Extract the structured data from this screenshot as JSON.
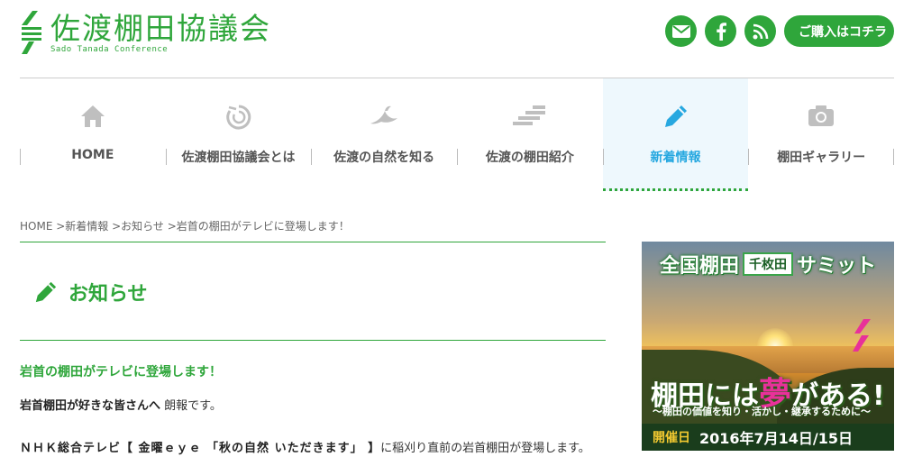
{
  "header": {
    "logo_title": "佐渡棚田協議会",
    "logo_subtitle": "Sado Tanada Conference",
    "icons": [
      "mail-icon",
      "facebook-icon",
      "rss-icon"
    ],
    "buy_label": "ご購入はコチラ"
  },
  "nav": {
    "items": [
      {
        "label": "HOME",
        "icon": "home-icon"
      },
      {
        "label": "佐渡棚田協議会とは",
        "icon": "swirl-icon"
      },
      {
        "label": "佐渡の自然を知る",
        "icon": "ibis-icon"
      },
      {
        "label": "佐渡の棚田紹介",
        "icon": "terrace-icon"
      },
      {
        "label": "新着情報",
        "icon": "pencil-icon",
        "active": true
      },
      {
        "label": "棚田ギャラリー",
        "icon": "camera-icon"
      }
    ]
  },
  "breadcrumb": "HOME >新着情報 >お知らせ >岩首の棚田がテレビに登場します！",
  "section": {
    "title": "お知らせ",
    "icon": "pencil-icon"
  },
  "article": {
    "title": "岩首の棚田がテレビに登場します！",
    "p1_strong": "岩首棚田が好きな皆さんへ",
    "p1_rest": " 朗報です。",
    "p2_strong": "ＮＨＫ総合テレビ【 金曜ｅｙｅ 「秋の自然 いただきます」 】",
    "p2_rest": "に稲刈り直前の岩首棚田が登場します。"
  },
  "banner": {
    "head1": "全国棚田",
    "head2": "千枚田",
    "head3": "サミット",
    "main_pre": "棚田には",
    "main_big": "夢",
    "main_post": "がある!",
    "subline": "〜棚田の価値を知り・活かし・継承するために〜",
    "foot_label": "開催日",
    "foot_date": "2016年7月14日/15日"
  },
  "colors": {
    "brand_green": "#2fa63b",
    "active_blue": "#27a8e0",
    "active_bg": "#eef8fd"
  }
}
